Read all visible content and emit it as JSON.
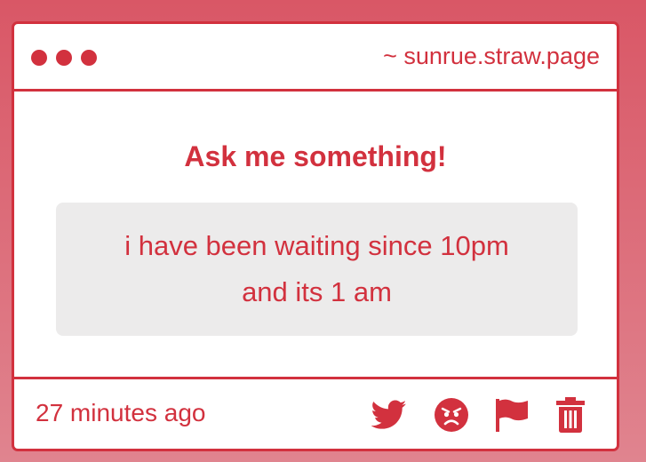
{
  "window": {
    "url": "~ sunrue.straw.page"
  },
  "main": {
    "heading": "Ask me something!",
    "question_lines": [
      "i have been waiting since 10pm",
      "and its 1 am"
    ]
  },
  "footer": {
    "timestamp": "27 minutes ago",
    "actions": [
      "twitter-icon",
      "angry-face-icon",
      "flag-icon",
      "trash-icon"
    ]
  },
  "colors": {
    "accent": "#d2313e",
    "question_bg": "#ecebeb",
    "background_top": "#d95766",
    "background_bottom": "#e0848f"
  }
}
